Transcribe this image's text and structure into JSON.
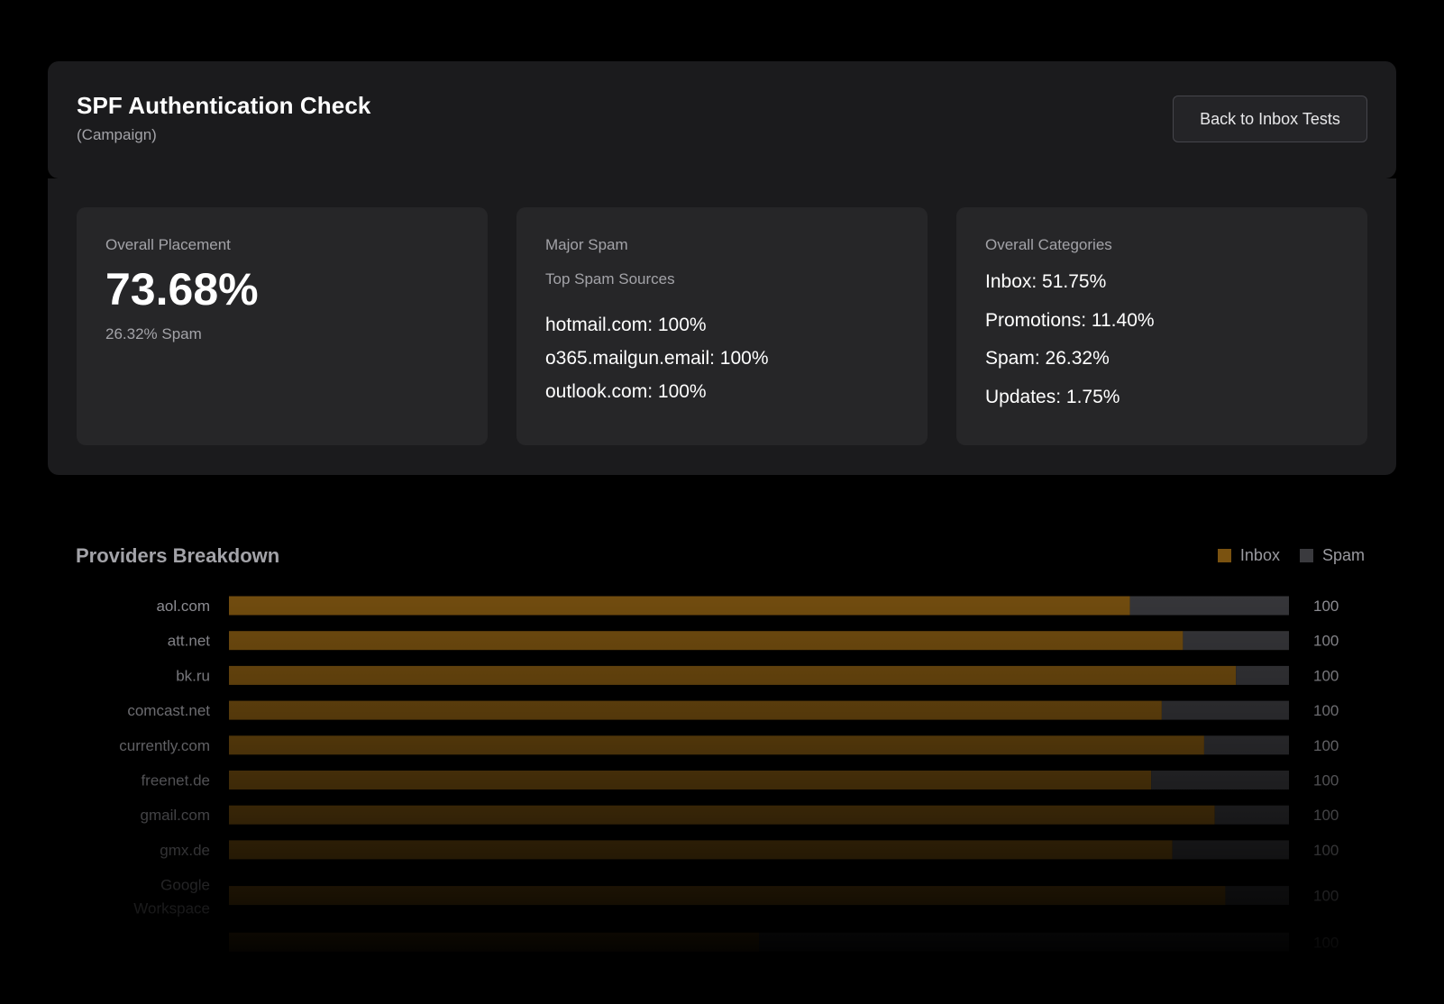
{
  "header": {
    "title": "SPF Authentication Check",
    "subtitle": "(Campaign)",
    "back_label": "Back to Inbox Tests"
  },
  "stats": {
    "placement": {
      "label": "Overall Placement",
      "value": "73.68%",
      "sub": "26.32% Spam"
    },
    "spam": {
      "label": "Major Spam",
      "sublabel": "Top Spam Sources",
      "items": [
        "hotmail.com: 100%",
        "o365.mailgun.email: 100%",
        "outlook.com: 100%"
      ]
    },
    "categories": {
      "label": "Overall Categories",
      "items": [
        "Inbox: 51.75%",
        "Promotions: 11.40%",
        "Spam: 26.32%",
        "Updates: 1.75%"
      ]
    }
  },
  "providers": {
    "title": "Providers Breakdown",
    "legend": {
      "inbox_label": "Inbox",
      "spam_label": "Spam",
      "inbox_color": "#7a5210",
      "spam_color": "#3a3a3e"
    }
  },
  "chart_data": {
    "type": "bar",
    "orientation": "horizontal",
    "stacked": true,
    "categories": [
      "aol.com",
      "att.net",
      "bk.ru",
      "comcast.net",
      "currently.com",
      "freenet.de",
      "gmail.com",
      "gmx.de",
      "Google Workspace",
      ""
    ],
    "series": [
      {
        "name": "Inbox",
        "values": [
          85,
          90,
          95,
          88,
          92,
          87,
          93,
          89,
          94,
          50
        ]
      },
      {
        "name": "Spam",
        "values": [
          15,
          10,
          5,
          12,
          8,
          13,
          7,
          11,
          6,
          50
        ]
      }
    ],
    "totals": [
      "100",
      "100",
      "100",
      "100",
      "100",
      "100",
      "100",
      "100",
      "100",
      "100"
    ],
    "xlim": [
      0,
      100
    ]
  }
}
